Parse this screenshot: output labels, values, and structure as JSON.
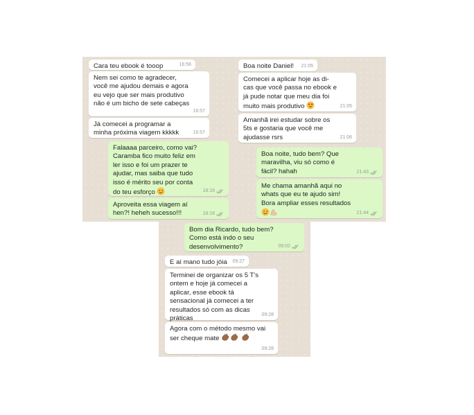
{
  "screenshots": [
    {
      "messages": [
        {
          "text": "Cara teu ebook é tooop",
          "time": "16:56",
          "direction": "in"
        },
        {
          "text": "Nem sei como te agradecer, você me ajudou demais e agora eu vejo que ser mais produtivo não é um bicho de sete cabeças",
          "time": "16:57",
          "direction": "in"
        },
        {
          "text": "Já comecei a programar a minha próxima viagem kkkkk",
          "time": "16:57",
          "direction": "in"
        },
        {
          "text": "Falaaaa parceiro, como vai? Caramba fico muito feliz em ler isso e foi um prazer te ajudar, mas saiba que tudo isso é mérito seu por conta do teu esforço",
          "emoji": "wink-face",
          "time": "18:18",
          "direction": "out"
        },
        {
          "text": "Aproveita essa viagem aí hen?! heheh sucesso!!!",
          "time": "18:18",
          "direction": "out"
        }
      ]
    },
    {
      "messages": [
        {
          "text": "Boa noite Daniel!",
          "time": "21:05",
          "direction": "in"
        },
        {
          "text": "Comecei a aplicar hoje as di- cas que você passa no ebook e já pude notar que meu dia foi muito mais produtivo",
          "emoji": "heart-eyes-face",
          "time": "21:05",
          "direction": "in"
        },
        {
          "text": "Amanhã irei estudar sobre os 5ts e gostaria que você me ajudasse rsrs",
          "time": "21:06",
          "direction": "in"
        },
        {
          "text": "Boa noite, tudo bem? Que maravilha, viu só como é fácil? hahah",
          "time": "21:43",
          "direction": "out"
        },
        {
          "text": "Me chama amanhã aqui no whats que eu te ajudo sim! Bora ampliar esses resultados",
          "emoji": "wink-face muscle",
          "time": "21:44",
          "direction": "out"
        }
      ]
    },
    {
      "messages": [
        {
          "text": "Bom dia Ricardo, tudo bem? Como está indo o seu desenvolvimento?",
          "time": "09:02",
          "direction": "out"
        },
        {
          "text": "E aí mano tudo jóia",
          "time": "09:27",
          "direction": "in"
        },
        {
          "text": "Terminei de organizar os 5 T's ontem e hoje já comecei a aplicar, esse ebook tá sensacional já comecei a ter resultados só com as dicas práticas",
          "time": "09:28",
          "direction": "in"
        },
        {
          "text": "Agora com o método mesmo vai ser cheque mate",
          "emoji": "clapping-hands x3",
          "time": "09:28",
          "direction": "in"
        }
      ]
    }
  ],
  "colors": {
    "incoming": "#ffffff",
    "outgoing": "#dcf8c6",
    "wallpaper": "#e7dfd4",
    "read_tick": "#4fc3f7",
    "sent_tick": "#9aa89a"
  }
}
